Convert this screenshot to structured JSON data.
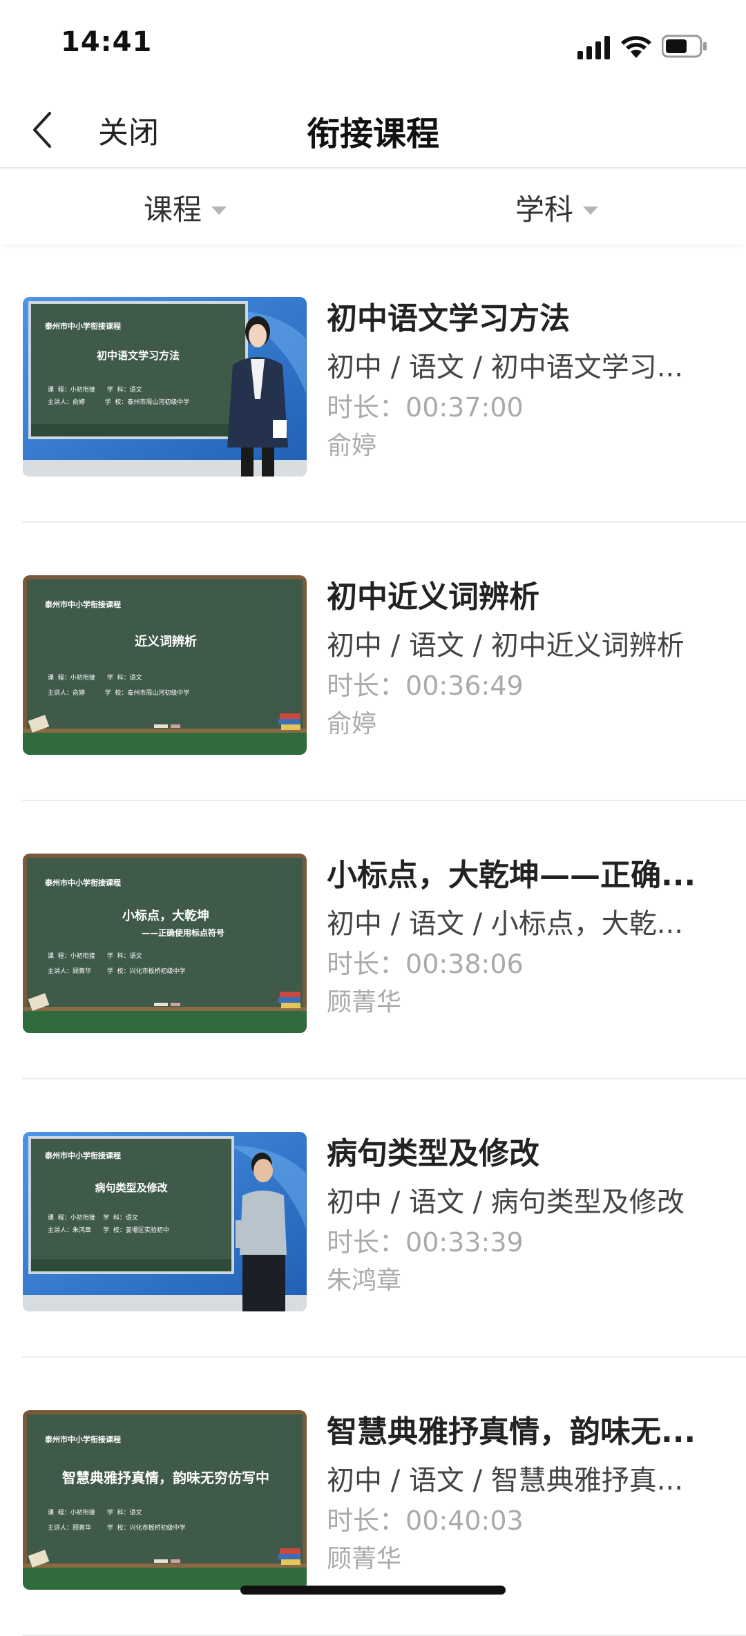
{
  "status_bar": {
    "time": "14:41"
  },
  "nav": {
    "back_label": "关闭",
    "title": "衔接课程"
  },
  "filters": [
    {
      "label": "课程"
    },
    {
      "label": "学科"
    }
  ],
  "courses": [
    {
      "title": "初中语文学习方法",
      "path": "初中 / 语文 / 初中语文学习...",
      "duration_label": "时长：",
      "duration": "00:37:00",
      "teacher": "俞婷",
      "thumb": {
        "style": "studio",
        "header": "泰州市中小学衔接课程",
        "title": "初中语文学习方法",
        "sub": "",
        "line1": "课  程：小初衔接      学  科：语文",
        "line2": "主讲人：俞婷          学  校：泰州市周山河初级中学"
      }
    },
    {
      "title": "初中近义词辨析",
      "path": "初中 / 语文 / 初中近义词辨析",
      "duration_label": "时长：",
      "duration": "00:36:49",
      "teacher": "俞婷",
      "thumb": {
        "style": "board",
        "header": "泰州市中小学衔接课程",
        "title": "近义词辨析",
        "sub": "",
        "line1": "课  程：小初衔接      学  科：语文",
        "line2": "主讲人：俞婷          学  校：泰州市周山河初级中学"
      }
    },
    {
      "title": "小标点，大乾坤——正确...",
      "path": "初中 / 语文 / 小标点，大乾...",
      "duration_label": "时长：",
      "duration": "00:38:06",
      "teacher": "顾菁华",
      "thumb": {
        "style": "board",
        "header": "泰州市中小学衔接课程",
        "title": "小标点，大乾坤",
        "sub": "——正确使用标点符号",
        "line1": "课  程：小初衔接      学  科：语文",
        "line2": "主讲人：顾菁华        学  校：兴化市板桥初级中学"
      }
    },
    {
      "title": "病句类型及修改",
      "path": "初中 / 语文 / 病句类型及修改",
      "duration_label": "时长：",
      "duration": "00:33:39",
      "teacher": "朱鸿章",
      "thumb": {
        "style": "studio2",
        "header": "泰州市中小学衔接课程",
        "title": "病句类型及修改",
        "sub": "",
        "line1": "课  程：小初衔接    学  科：语文",
        "line2": "主讲人：朱鸿章      学  校：姜堰区实验初中"
      }
    },
    {
      "title": "智慧典雅抒真情，韵味无...",
      "path": "初中 / 语文 / 智慧典雅抒真...",
      "duration_label": "时长：",
      "duration": "00:40:03",
      "teacher": "顾菁华",
      "thumb": {
        "style": "board",
        "header": "泰州市中小学衔接课程",
        "title": "智慧典雅抒真情，韵味无穷仿写中",
        "sub": "",
        "line1": "课  程：小初衔接      学  科：语文",
        "line2": "主讲人：顾菁华        学  校：兴化市板桥初级中学"
      }
    }
  ],
  "colors": {
    "board_green": "#3f5a49",
    "board_frame": "#7a5a3a",
    "studio_blue": "#2f7bd0"
  }
}
